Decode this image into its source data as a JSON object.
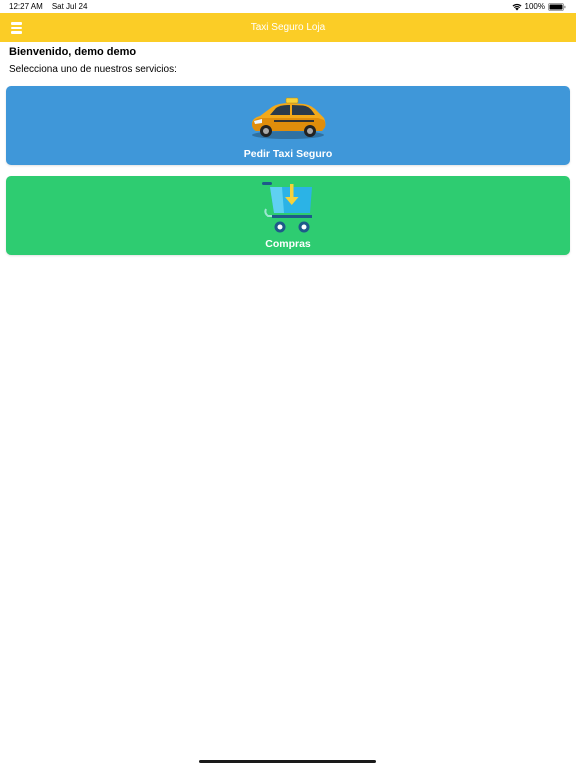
{
  "status_bar": {
    "time": "12:27 AM",
    "date": "Sat Jul 24",
    "battery": "100%",
    "wifi_icon": "wifi-icon",
    "battery_icon": "battery-icon"
  },
  "header": {
    "title": "Taxi Seguro Loja",
    "menu_icon": "hamburger-menu-icon",
    "background_color": "#fbcd26"
  },
  "welcome": {
    "title": "Bienvenido, demo demo",
    "subtitle": "Selecciona uno de nuestros servicios:"
  },
  "services": [
    {
      "label": "Pedir Taxi Seguro",
      "icon": "taxi-car-icon",
      "color": "#3f97d9"
    },
    {
      "label": "Compras",
      "icon": "shopping-cart-icon",
      "color": "#2ecc71"
    }
  ]
}
